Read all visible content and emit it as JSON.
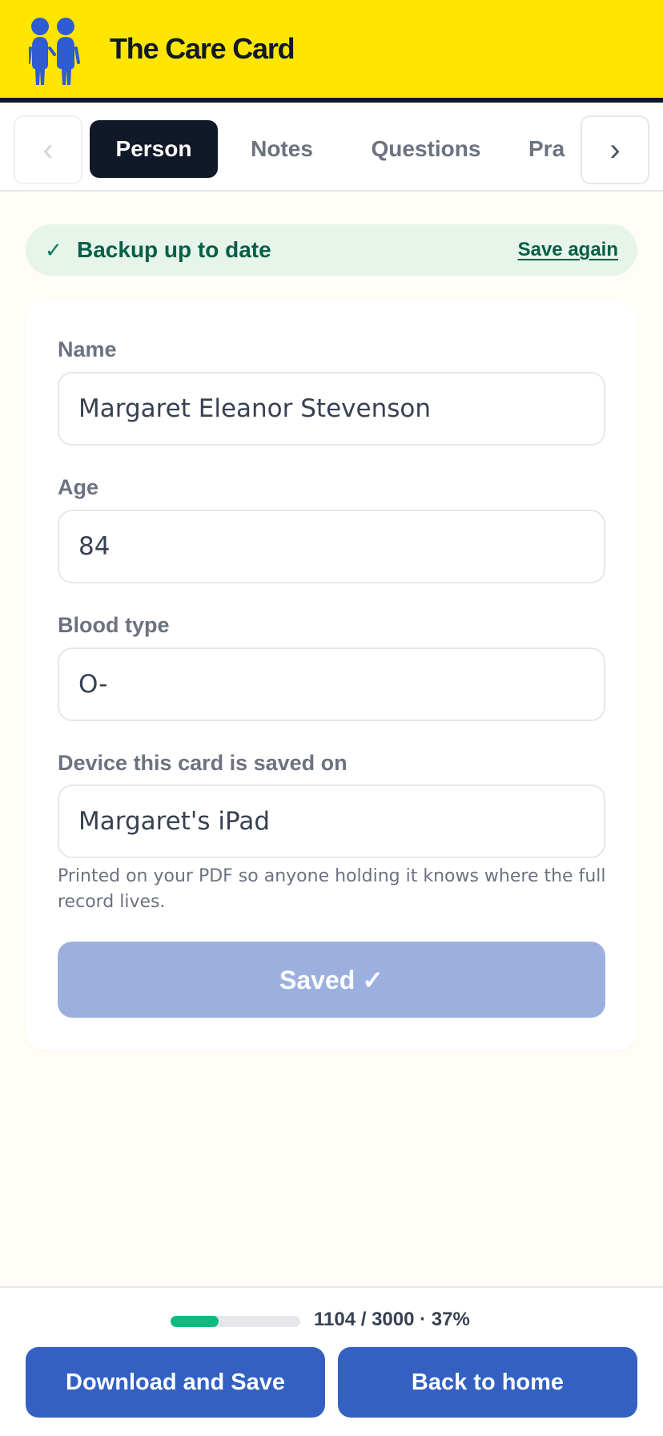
{
  "header": {
    "title": "The Care Card",
    "logo_icon": "two-people-icon",
    "background": "#ffe600"
  },
  "tabs": {
    "prev_icon": "‹",
    "next_icon": "›",
    "items": [
      {
        "label": "Person",
        "active": true
      },
      {
        "label": "Notes",
        "active": false
      },
      {
        "label": "Questions",
        "active": false
      },
      {
        "label": "Pra",
        "active": false
      }
    ]
  },
  "backup": {
    "check_icon": "✓",
    "status": "Backup up to date",
    "action": "Save again"
  },
  "form": {
    "name": {
      "label": "Name",
      "value": "Margaret Eleanor Stevenson"
    },
    "age": {
      "label": "Age",
      "value": "84"
    },
    "blood_type": {
      "label": "Blood type",
      "value": "O-"
    },
    "device": {
      "label": "Device this card is saved on",
      "value": "Margaret's iPad"
    },
    "helper_text": "Printed on your PDF so anyone holding it knows where the full record lives.",
    "save_button": "Saved ✓"
  },
  "footer": {
    "progress_text": "1104 / 3000 · 37%",
    "progress_fraction": 0.37,
    "download_button": "Download and Save",
    "home_button": "Back to home"
  },
  "colors": {
    "accent_blue": "#3360c1",
    "success_green": "#10b981",
    "header_yellow": "#ffe600"
  }
}
